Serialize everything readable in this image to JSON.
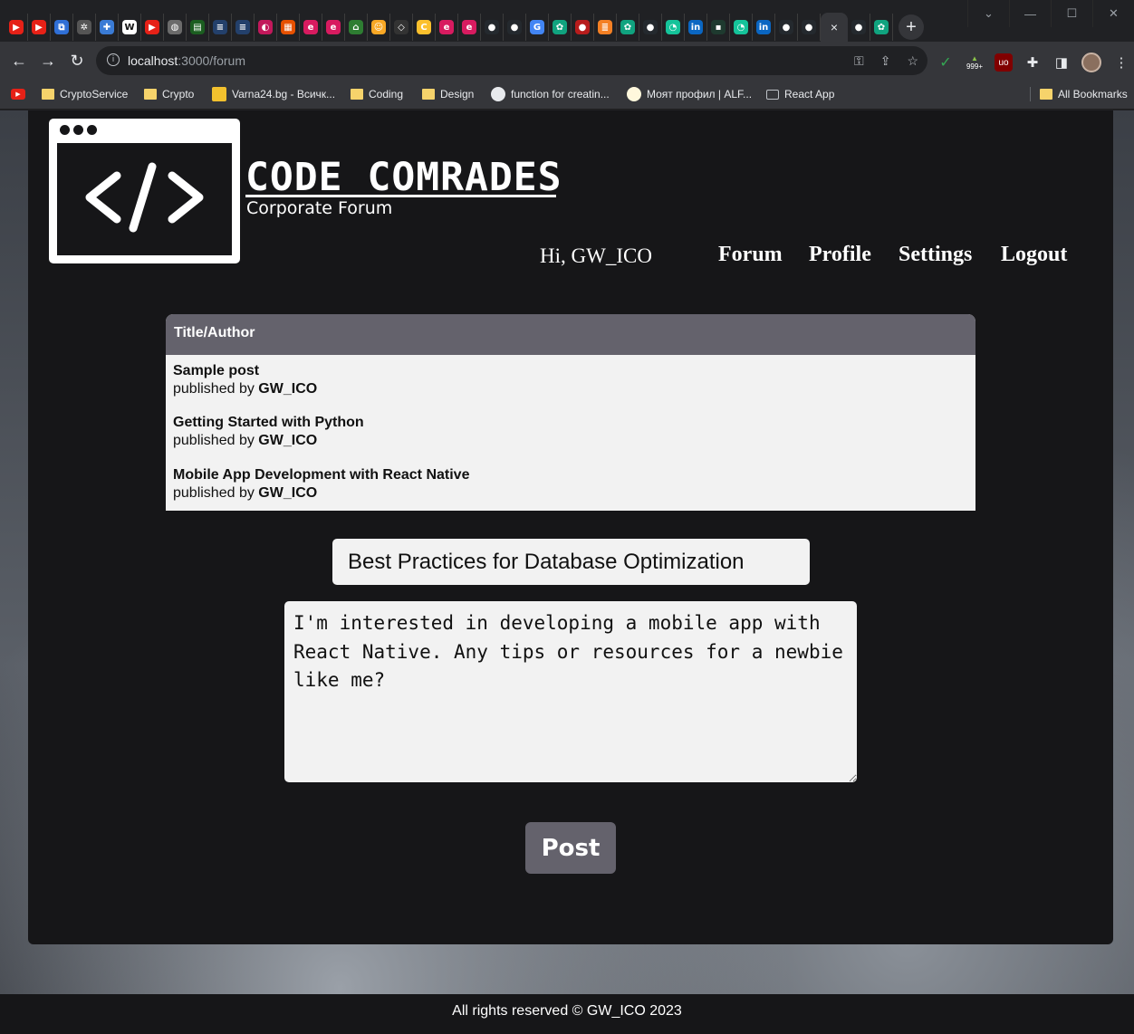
{
  "browser": {
    "url_host": "localhost",
    "url_path": ":3000/forum",
    "active_tab_close": "×",
    "new_tab": "+",
    "window_controls": [
      "⌄",
      "—",
      "☐",
      "✕"
    ],
    "tab_favicons": [
      {
        "icon": "youtube-icon",
        "color": "#e62117",
        "glyph": "▶"
      },
      {
        "icon": "youtube-icon",
        "color": "#e62117",
        "glyph": "▶"
      },
      {
        "icon": "windows-icon",
        "color": "#2f6fd6",
        "glyph": "⧉"
      },
      {
        "icon": "gear-icon",
        "color": "#555555",
        "glyph": "✲"
      },
      {
        "icon": "puzzle-icon",
        "color": "#3a7bd5",
        "glyph": "✚"
      },
      {
        "icon": "wikipedia-icon",
        "color": "#ffffff",
        "glyph": "W"
      },
      {
        "icon": "youtube-icon",
        "color": "#e62117",
        "glyph": "▶"
      },
      {
        "icon": "globe-icon",
        "color": "#6b6b6b",
        "glyph": "◍"
      },
      {
        "icon": "chart-icon",
        "color": "#1b5e20",
        "glyph": "▤"
      },
      {
        "icon": "site-icon",
        "color": "#23406b",
        "glyph": "≡"
      },
      {
        "icon": "site-icon",
        "color": "#23406b",
        "glyph": "≡"
      },
      {
        "icon": "site-icon",
        "color": "#c2185b",
        "glyph": "◐"
      },
      {
        "icon": "am-icon",
        "color": "#e65100",
        "glyph": "▦"
      },
      {
        "icon": "e-icon",
        "color": "#d81b60",
        "glyph": "e"
      },
      {
        "icon": "e-icon",
        "color": "#d81b60",
        "glyph": "e"
      },
      {
        "icon": "home-icon",
        "color": "#2e7d32",
        "glyph": "⌂"
      },
      {
        "icon": "smile-icon",
        "color": "#f9a825",
        "glyph": "☺"
      },
      {
        "icon": "code-icon",
        "color": "#333333",
        "glyph": "◇"
      },
      {
        "icon": "c-icon",
        "color": "#fbc02d",
        "glyph": "C"
      },
      {
        "icon": "e-icon",
        "color": "#d81b60",
        "glyph": "e"
      },
      {
        "icon": "e-icon",
        "color": "#d81b60",
        "glyph": "e"
      },
      {
        "icon": "github-icon",
        "color": "#24292e",
        "glyph": "●"
      },
      {
        "icon": "github-icon",
        "color": "#24292e",
        "glyph": "●"
      },
      {
        "icon": "google-icon",
        "color": "#4285f4",
        "glyph": "G"
      },
      {
        "icon": "chatgpt-icon",
        "color": "#10a37f",
        "glyph": "✿"
      },
      {
        "icon": "record-icon",
        "color": "#b71c1c",
        "glyph": "●"
      },
      {
        "icon": "stack-icon",
        "color": "#f48024",
        "glyph": "≣"
      },
      {
        "icon": "chatgpt-icon",
        "color": "#10a37f",
        "glyph": "✿"
      },
      {
        "icon": "github-icon",
        "color": "#24292e",
        "glyph": "●"
      },
      {
        "icon": "grammarly-icon",
        "color": "#15c39a",
        "glyph": "◔"
      },
      {
        "icon": "linkedin-icon",
        "color": "#0a66c2",
        "glyph": "in"
      },
      {
        "icon": "site-icon",
        "color": "#1e3a2f",
        "glyph": "▪"
      },
      {
        "icon": "grammarly-icon",
        "color": "#15c39a",
        "glyph": "◔"
      },
      {
        "icon": "linkedin-icon",
        "color": "#0a66c2",
        "glyph": "in"
      },
      {
        "icon": "github-icon",
        "color": "#24292e",
        "glyph": "●"
      },
      {
        "icon": "github-icon",
        "color": "#24292e",
        "glyph": "●"
      }
    ],
    "tab_favicons_after": [
      {
        "icon": "github-icon",
        "color": "#24292e",
        "glyph": "●"
      },
      {
        "icon": "chatgpt-icon",
        "color": "#10a37f",
        "glyph": "✿"
      }
    ],
    "extension_badge": "999+",
    "bookmarks": [
      {
        "label": "",
        "icon": "youtube-icon"
      },
      {
        "label": "CryptoService",
        "icon": "folder-icon"
      },
      {
        "label": "Crypto",
        "icon": "folder-icon"
      },
      {
        "label": "Varna24.bg - Всичк...",
        "icon": "site-icon"
      },
      {
        "label": "Coding",
        "icon": "folder-icon"
      },
      {
        "label": "Design",
        "icon": "folder-icon"
      },
      {
        "label": "function for creatin...",
        "icon": "github-icon"
      },
      {
        "label": "Моят профил | ALF...",
        "icon": "site-icon"
      },
      {
        "label": "React App",
        "icon": "page-icon"
      },
      {
        "label": "All Bookmarks",
        "icon": "folder-icon"
      }
    ]
  },
  "site": {
    "logo_glyph": "</>",
    "brand_title": "CODE COMRADES",
    "brand_subtitle": "Corporate Forum",
    "greeting": "Hi, GW_ICO",
    "nav": [
      "Forum",
      "Profile",
      "Settings",
      "Logout"
    ]
  },
  "posts_table": {
    "header": "Title/Author",
    "published_by": "published by",
    "rows": [
      {
        "title": "Sample post",
        "author": "GW_ICO"
      },
      {
        "title": "Getting Started with Python",
        "author": "GW_ICO"
      },
      {
        "title": "Mobile App Development with React Native",
        "author": "GW_ICO"
      }
    ]
  },
  "new_post": {
    "title_value": "Best Practices for Database Optimization",
    "content_value": "I'm interested in developing a mobile app with React Native. Any tips or resources for a newbie like me?",
    "submit_label": "Post"
  },
  "footer": {
    "text": "All rights reserved ©   GW_ICO 2023"
  },
  "colors": {
    "panel": "#161618",
    "accent": "#64626c",
    "table_bg": "#f2f2f2"
  }
}
